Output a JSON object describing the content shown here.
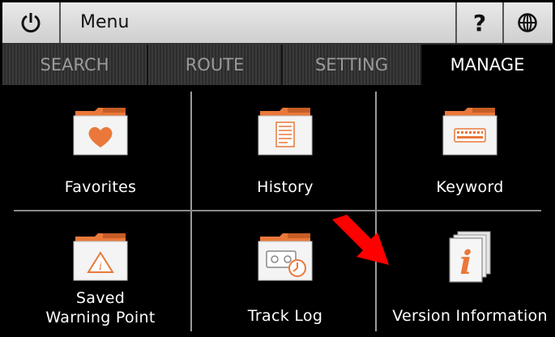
{
  "topbar": {
    "power_icon": "power-icon",
    "title": "Menu",
    "help_label": "?",
    "globe_icon": "globe-icon"
  },
  "tabs": [
    {
      "label": "SEARCH",
      "active": false
    },
    {
      "label": "ROUTE",
      "active": false
    },
    {
      "label": "SETTING",
      "active": false
    },
    {
      "label": "MANAGE",
      "active": true
    }
  ],
  "items": [
    {
      "label": "Favorites",
      "icon": "heart-folder-icon"
    },
    {
      "label": "History",
      "icon": "document-folder-icon"
    },
    {
      "label": "Keyword",
      "icon": "keyboard-folder-icon"
    },
    {
      "label_line1": "Saved",
      "label_line2": "Warning Point",
      "icon": "warning-folder-icon"
    },
    {
      "label": "Track Log",
      "icon": "tracklog-folder-icon"
    },
    {
      "label": "Version Information",
      "icon": "info-document-icon"
    }
  ],
  "colors": {
    "accent": "#e9783a",
    "arrow": "#ff0000",
    "background": "#000000",
    "topbar": "#dcdcdc"
  }
}
